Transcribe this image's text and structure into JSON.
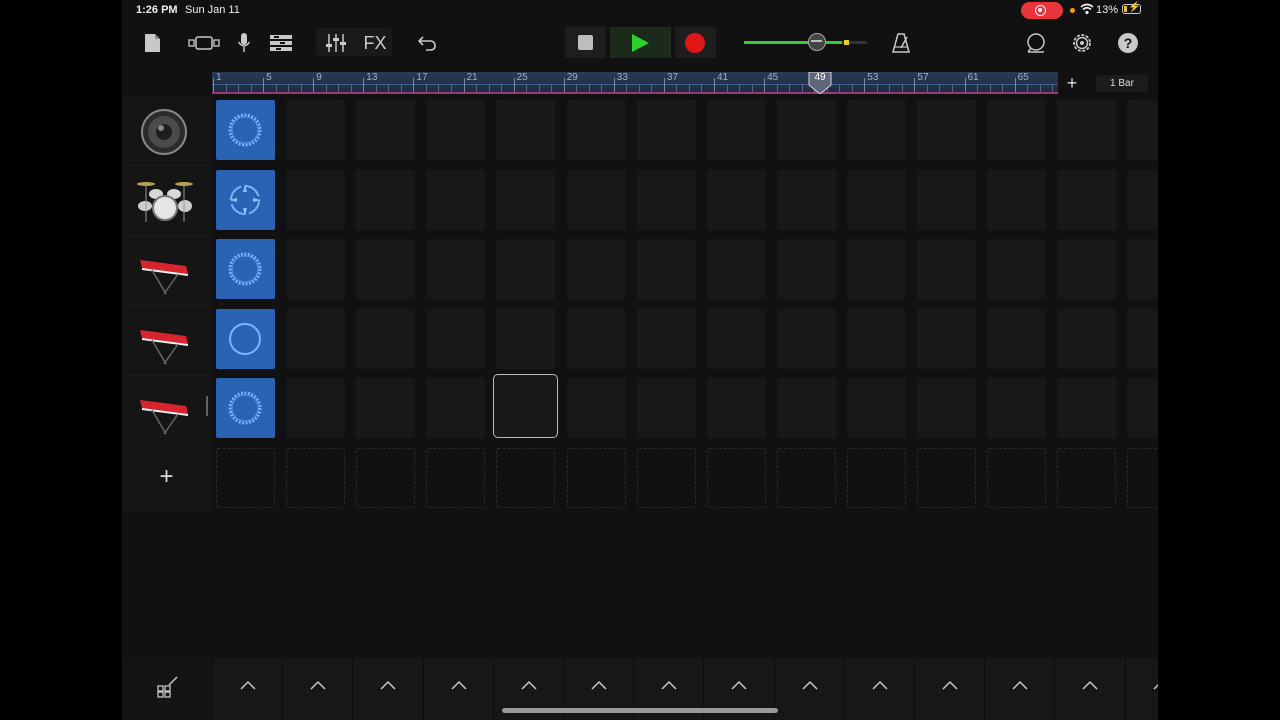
{
  "status_bar": {
    "time": "1:26 PM",
    "date": "Sun Jan 11",
    "battery": "13%"
  },
  "toolbar": {
    "fx_label": "FX",
    "snap_label": "1 Bar",
    "add_section_label": "+"
  },
  "ruler": {
    "labels": [
      "1",
      "5",
      "9",
      "13",
      "17",
      "21",
      "25",
      "29",
      "33",
      "37",
      "41",
      "45",
      "49",
      "53",
      "57",
      "61",
      "65"
    ],
    "playhead_bar": "49"
  },
  "tracks": [
    {
      "instrument": "speaker-icon",
      "clip_icon": "loop-ring-icon"
    },
    {
      "instrument": "drum-kit-icon",
      "clip_icon": "beat-sequencer-icon"
    },
    {
      "instrument": "keyboard-icon",
      "clip_icon": "loop-ring-icon"
    },
    {
      "instrument": "keyboard-icon",
      "clip_icon": "circle-icon"
    },
    {
      "instrument": "keyboard-icon",
      "clip_icon": "loop-ring-icon"
    }
  ],
  "add_track_label": "+",
  "grid": {
    "columns": 14,
    "rows": 5,
    "selected_cell": {
      "row": 4,
      "col": 4
    }
  },
  "colors": {
    "clip_fill": "#2a62b4",
    "play_green": "#2bd12b",
    "record_red": "#e01515",
    "status_rec_red": "#e8343a"
  }
}
